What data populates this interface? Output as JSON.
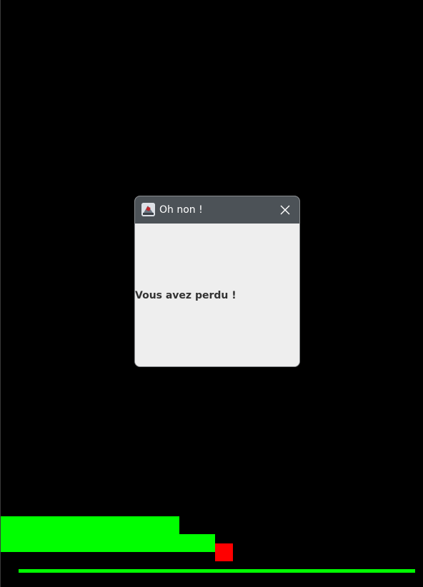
{
  "game": {
    "background_color": "#000000",
    "stack_color": "#00ff00",
    "piece_color": "#ff0000",
    "ground_color": "#00ff00"
  },
  "dialog": {
    "title": "Oh non !",
    "message": "Vous avez perdu !",
    "app_icon": "java-app-icon",
    "close_icon": "close-icon",
    "titlebar_color": "#4c5257",
    "body_color": "#eeeeee"
  }
}
